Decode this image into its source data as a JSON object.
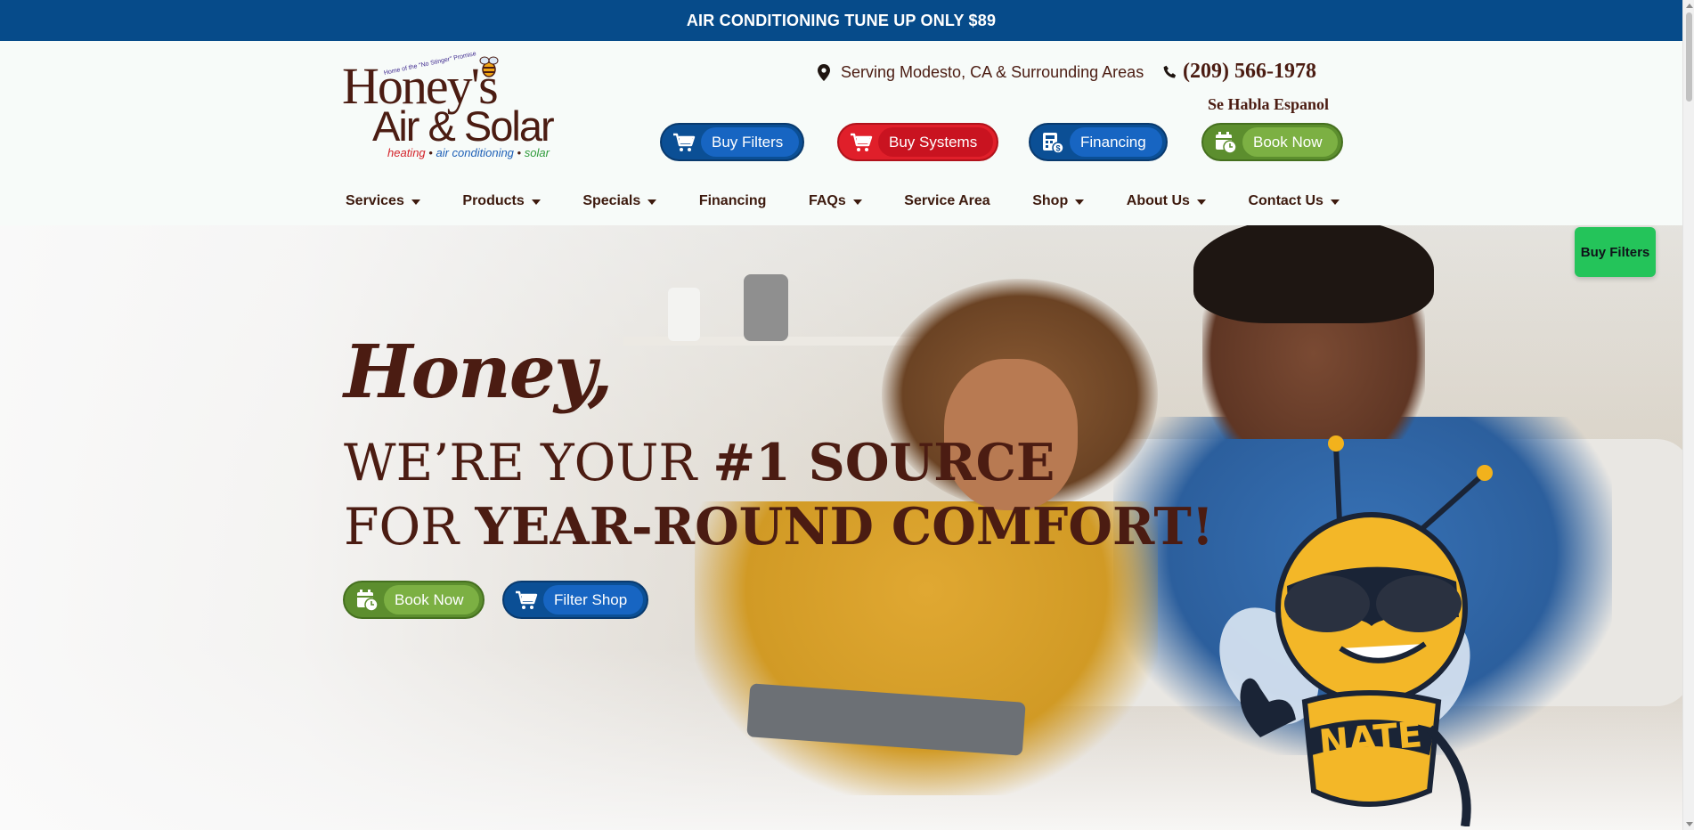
{
  "banner": {
    "text": "AIR CONDITIONING TUNE UP ONLY $89"
  },
  "logo": {
    "tagline": "Home of the \"No Stinger\" Promise",
    "line1": "Honey's",
    "line2": "Air & Solar",
    "sub_heating": "heating",
    "sub_air": "air conditioning",
    "sub_solar": "solar",
    "sep": "•"
  },
  "header": {
    "location": "Serving Modesto, CA & Surrounding Areas",
    "phone": "(209) 566-1978",
    "spanish": "Se Habla Espanol",
    "buttons": {
      "buy_filters": "Buy Filters",
      "buy_systems": "Buy Systems",
      "financing": "Financing",
      "book_now": "Book Now"
    }
  },
  "nav": {
    "items": [
      {
        "label": "Services"
      },
      {
        "label": "Products"
      },
      {
        "label": "Specials"
      },
      {
        "label": "Financing"
      },
      {
        "label": "FAQs"
      },
      {
        "label": "Service Area"
      },
      {
        "label": "Shop"
      },
      {
        "label": "About Us"
      },
      {
        "label": "Contact Us"
      }
    ]
  },
  "hero": {
    "script": "Honey,",
    "line1_light": "WE’RE YOUR ",
    "line1_bold": "#1 SOURCE",
    "line2_light": "FOR ",
    "line2_bold": "YEAR-ROUND COMFORT!",
    "book_now": "Book Now",
    "filter_shop": "Filter Shop",
    "mascot_badge": "NATE"
  },
  "floating": {
    "buy_filters": "Buy Filters"
  },
  "colors": {
    "brand_brown": "#4b1c12",
    "banner_blue": "#064b8a",
    "pill_blue": "#1765c2",
    "pill_red": "#c91320",
    "pill_green": "#7cb043",
    "float_green": "#24c45a"
  }
}
